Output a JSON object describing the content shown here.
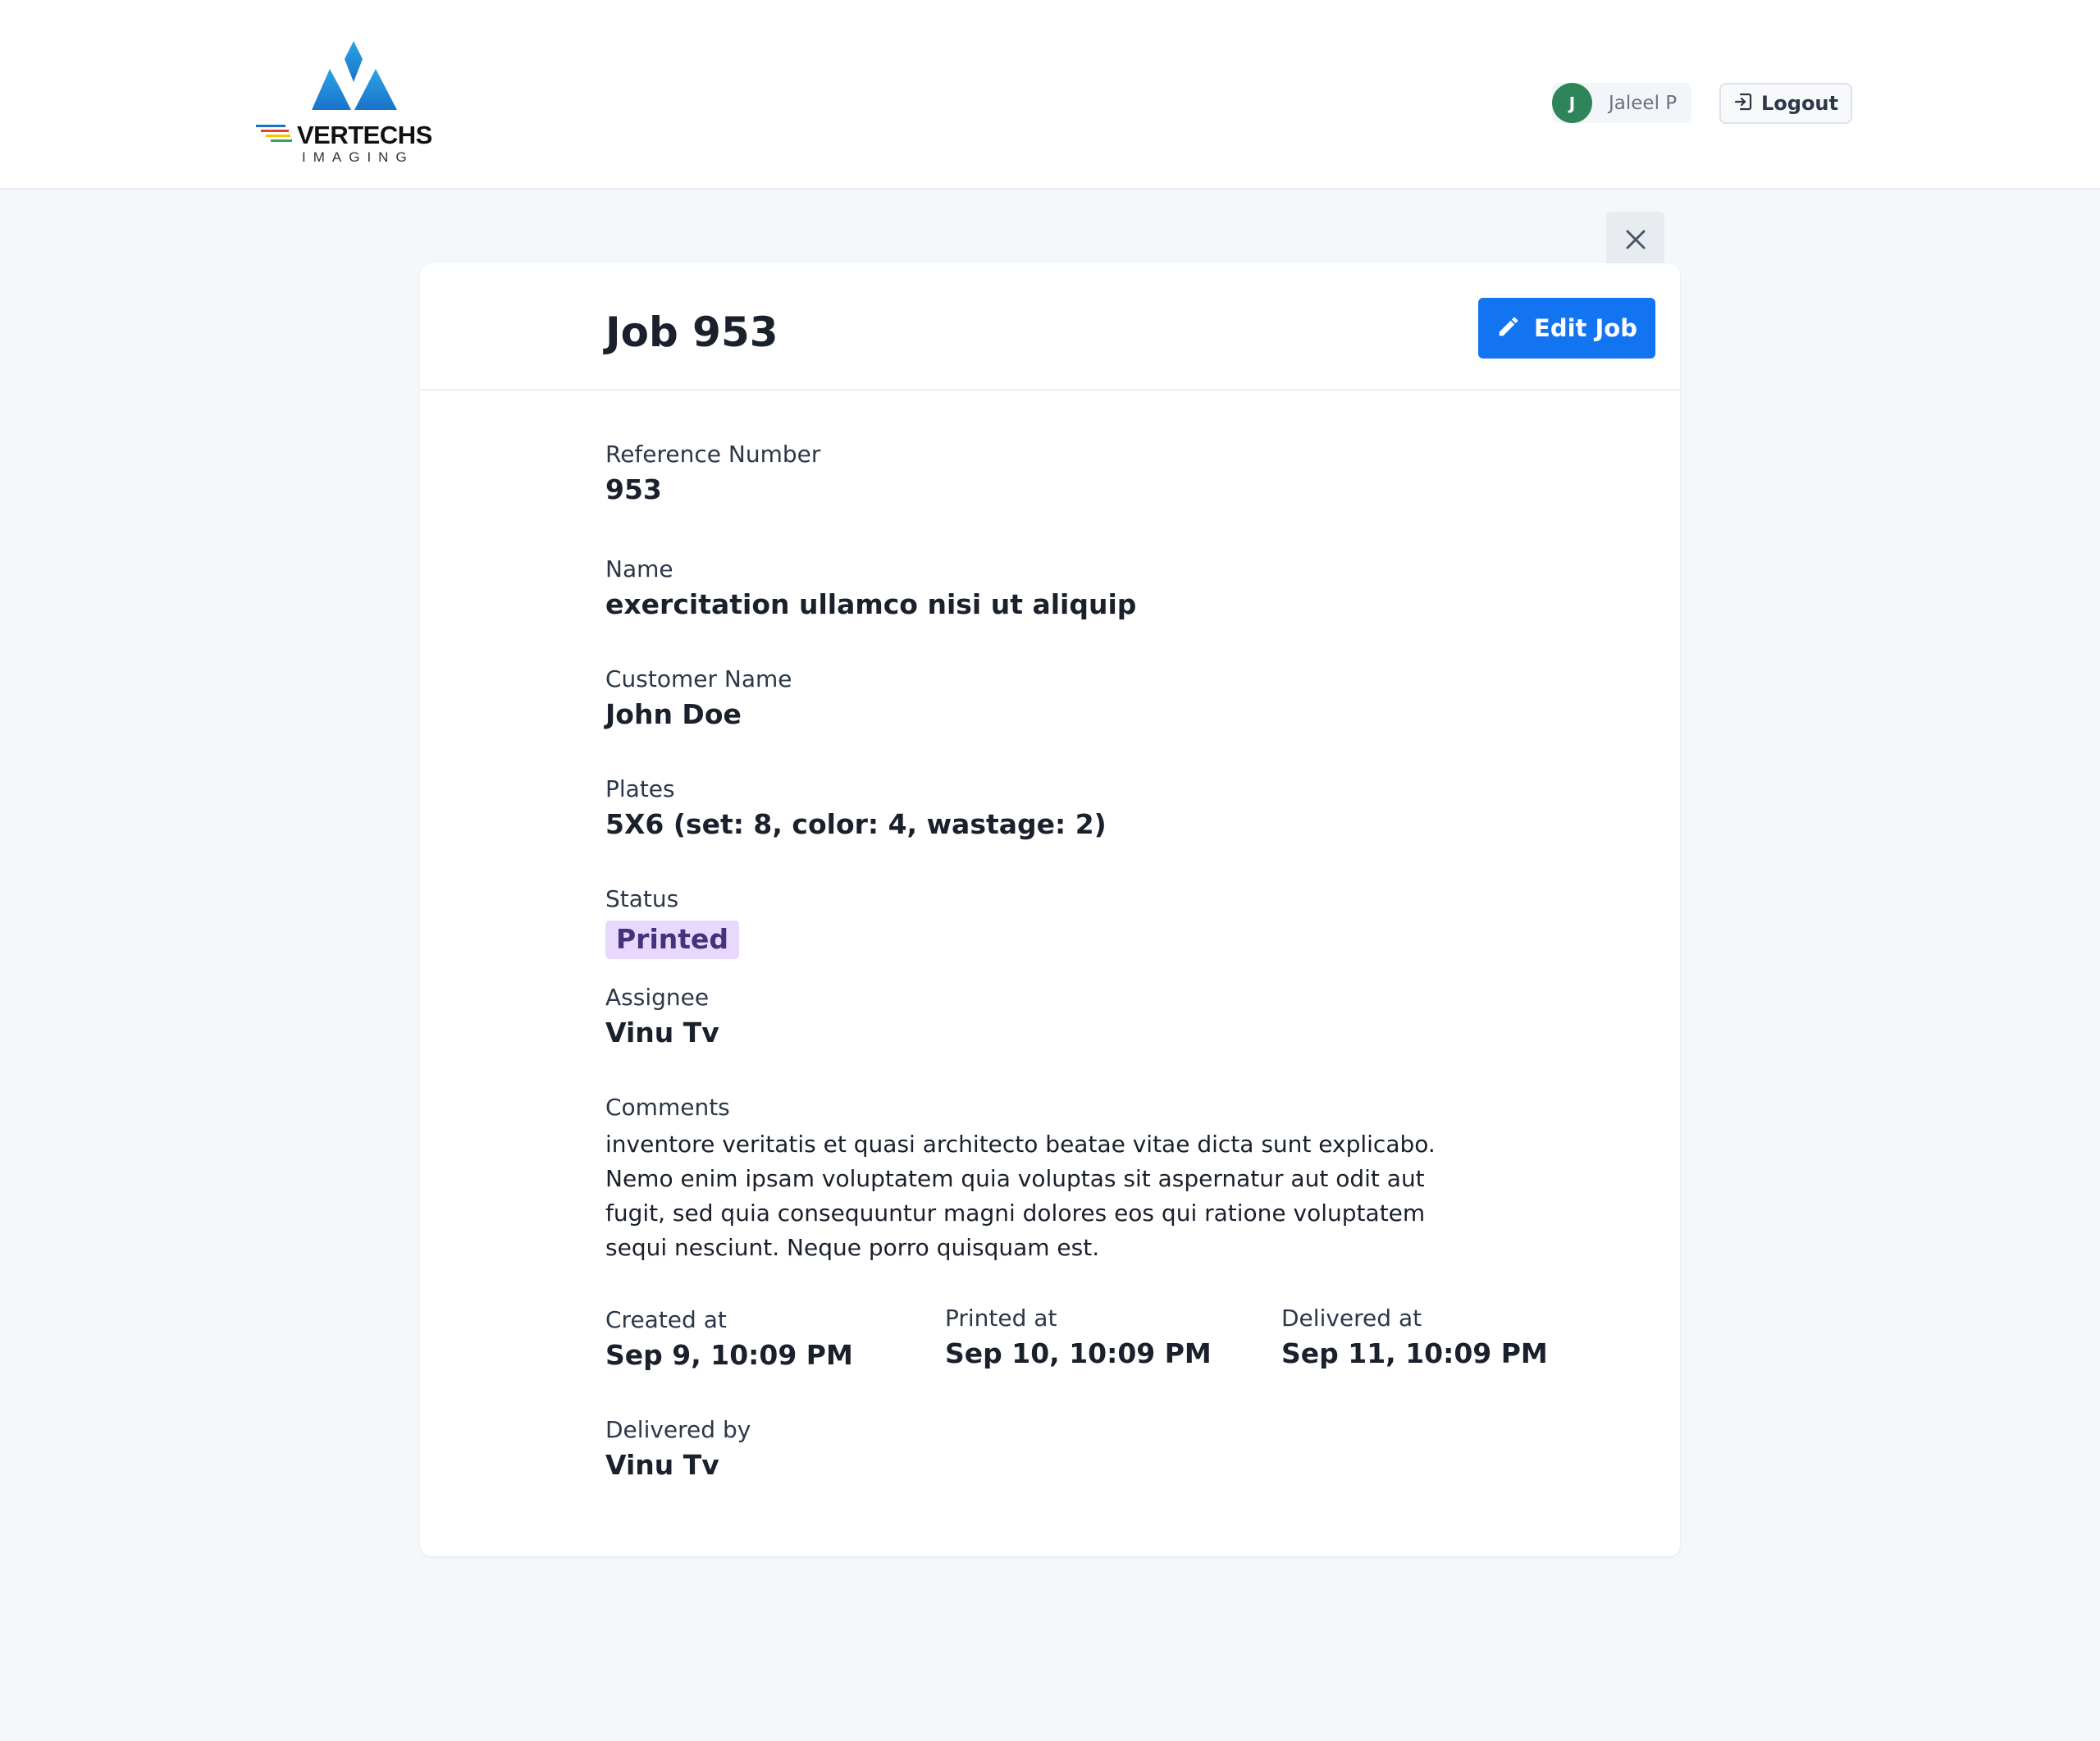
{
  "header": {
    "logo": {
      "word": "VERTECHS",
      "sub": "IMAGING",
      "colors": {
        "primary": "#1a73c8",
        "light": "#2aa3e6"
      }
    },
    "user": {
      "initial": "J",
      "name": "Jaleel P",
      "avatar_color": "#2f855a"
    },
    "logout_label": "Logout"
  },
  "job": {
    "title": "Job 953",
    "edit_label": "Edit Job",
    "fields": {
      "reference": {
        "label": "Reference Number",
        "value": "953"
      },
      "name": {
        "label": "Name",
        "value": "exercitation ullamco nisi ut aliquip"
      },
      "customer": {
        "label": "Customer Name",
        "value": "John Doe"
      },
      "plates": {
        "label": "Plates",
        "value": "5X6 (set: 8, color: 4, wastage: 2)"
      },
      "status": {
        "label": "Status",
        "value": "Printed",
        "color": "#e9d8fd"
      },
      "assignee": {
        "label": "Assignee",
        "value": "Vinu Tv"
      },
      "comments": {
        "label": "Comments",
        "value": "inventore veritatis et quasi architecto beatae vitae dicta sunt explicabo. Nemo enim ipsam voluptatem quia voluptas sit aspernatur aut odit aut fugit, sed quia consequuntur magni dolores eos qui ratione voluptatem sequi nesciunt. Neque porro quisquam est."
      },
      "created_at": {
        "label": "Created at",
        "value": "Sep 9, 10:09 PM"
      },
      "printed_at": {
        "label": "Printed at",
        "value": "Sep 10, 10:09 PM"
      },
      "delivered_at": {
        "label": "Delivered at",
        "value": "Sep 11, 10:09 PM"
      },
      "delivered_by": {
        "label": "Delivered by",
        "value": "Vinu Tv"
      }
    }
  },
  "colors": {
    "accent": "#1374f2",
    "background": "#f5f8fb"
  },
  "icons": {
    "close": "close-icon",
    "edit": "pencil-icon",
    "logout": "logout-icon"
  }
}
